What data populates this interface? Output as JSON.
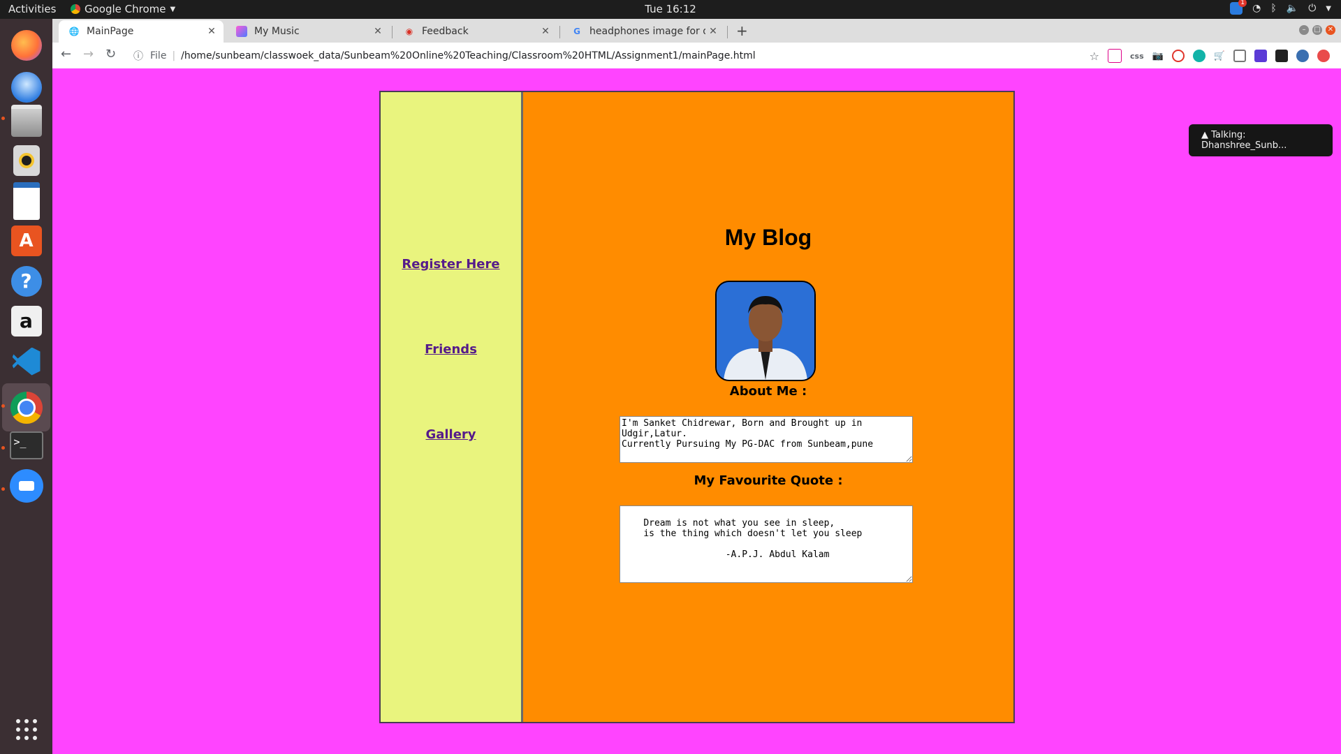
{
  "system": {
    "activities": "Activities",
    "app_name": "Google Chrome",
    "clock": "Tue 16:12",
    "notification_count": "1"
  },
  "dock": [
    "firefox-icon",
    "thunderbird-icon",
    "files-icon",
    "rhythmbox-icon",
    "libreoffice-writer-icon",
    "software-center-icon",
    "help-icon",
    "amazon-icon",
    "vscode-icon",
    "chrome-icon",
    "terminal-icon",
    "zoom-icon",
    "show-apps-icon"
  ],
  "tabs": [
    {
      "title": "MainPage",
      "active": true
    },
    {
      "title": "My Music",
      "active": false
    },
    {
      "title": "Feedback",
      "active": false
    },
    {
      "title": "headphones image for de",
      "active": false
    }
  ],
  "toolbar": {
    "scheme_label": "File",
    "url": "/home/sunbeam/classwoek_data/Sunbeam%20Online%20Teaching/Classroom%20HTML/Assignment1/mainPage.html",
    "ext_css": "css"
  },
  "sidebar": {
    "links": [
      "Register Here",
      "Friends",
      "Gallery"
    ]
  },
  "blog": {
    "title": "My Blog",
    "about_heading": "About Me :",
    "about_text": "I'm Sanket Chidrewar, Born and Brought up in Udgir,Latur.\nCurrently Pursuing My PG-DAC from Sunbeam,pune",
    "quote_heading": "My Favourite Quote :",
    "quote_text": "\n    Dream is not what you see in sleep,\n    is the thing which doesn't let you sleep\n\n                   -A.P.J. Abdul Kalam"
  },
  "notification": {
    "text": "▲ Talking: Dhanshree_Sunb..."
  },
  "colors": {
    "page_bg": "#ff44ff",
    "left_frame_bg": "#e9f47e",
    "right_frame_bg": "#ff8c00",
    "link": "#551a8b"
  }
}
